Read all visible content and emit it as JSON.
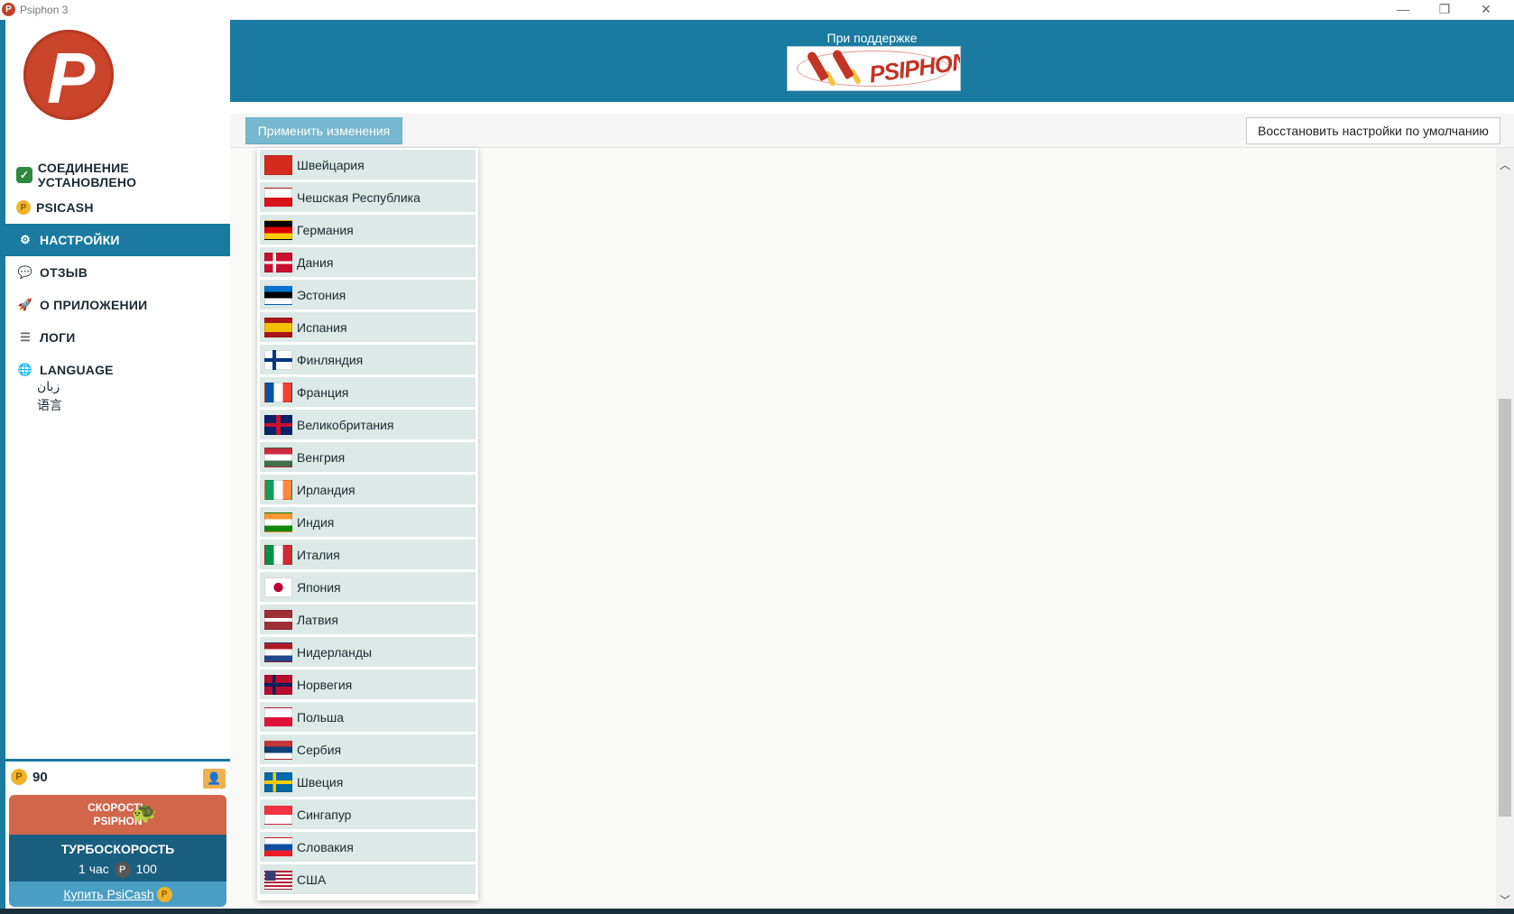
{
  "window": {
    "title": "Psiphon 3",
    "minimize": "—",
    "restore": "❐",
    "close": "✕"
  },
  "sidebar": {
    "logo_letter": "P",
    "items": [
      {
        "label": "СОЕДИНЕНИЕ УСТАНОВЛЕНО",
        "icon": "check-icon",
        "glyph": "✓"
      },
      {
        "label": "PSICASH",
        "icon": "psicash-coin-icon",
        "glyph": "P"
      },
      {
        "label": "НАСТРОЙКИ",
        "icon": "gear-icon",
        "glyph": "⚙"
      },
      {
        "label": "ОТЗЫВ",
        "icon": "chat-bubble-icon",
        "glyph": "💬"
      },
      {
        "label": "О ПРИЛОЖЕНИИ",
        "icon": "rocket-icon",
        "glyph": "🚀"
      },
      {
        "label": "ЛОГИ",
        "icon": "list-icon",
        "glyph": "☰"
      },
      {
        "label": "LANGUAGE",
        "icon": "globe-icon",
        "glyph": "🌐"
      }
    ],
    "language_alt": [
      "زبان",
      "语言"
    ]
  },
  "psicash": {
    "balance": "90",
    "coin_glyph": "P",
    "account_glyph": "👤",
    "speed_line1": "СКОРОСТЬ",
    "speed_line2": "PSIPHON",
    "turbo_title": "ТУРБОСКОРОСТЬ",
    "turbo_duration": "1 час",
    "turbo_price": "100",
    "buy_label": "Купить PsiCash"
  },
  "header": {
    "sponsor_label": "При поддержке",
    "sponsor_word": "PSIPHON"
  },
  "toolbar": {
    "apply_label": "Применить изменения",
    "reset_label": "Восстановить настройки по умолчанию"
  },
  "scrollbar": {
    "up": "︿",
    "down": "﹀"
  },
  "countries": [
    {
      "name": "Швейцария",
      "flag": "ch"
    },
    {
      "name": "Чешская Республика",
      "flag": "cz"
    },
    {
      "name": "Германия",
      "flag": "de"
    },
    {
      "name": "Дания",
      "flag": "dk"
    },
    {
      "name": "Эстония",
      "flag": "ee"
    },
    {
      "name": "Испания",
      "flag": "es"
    },
    {
      "name": "Финляндия",
      "flag": "fi"
    },
    {
      "name": "Франция",
      "flag": "fr"
    },
    {
      "name": "Великобритания",
      "flag": "gb"
    },
    {
      "name": "Венгрия",
      "flag": "hu"
    },
    {
      "name": "Ирландия",
      "flag": "ie"
    },
    {
      "name": "Индия",
      "flag": "in"
    },
    {
      "name": "Италия",
      "flag": "it"
    },
    {
      "name": "Япония",
      "flag": "jp"
    },
    {
      "name": "Латвия",
      "flag": "lv"
    },
    {
      "name": "Нидерланды",
      "flag": "nl"
    },
    {
      "name": "Норвегия",
      "flag": "no"
    },
    {
      "name": "Польша",
      "flag": "pl"
    },
    {
      "name": "Сербия",
      "flag": "rs"
    },
    {
      "name": "Швеция",
      "flag": "se"
    },
    {
      "name": "Сингапур",
      "flag": "sg"
    },
    {
      "name": "Словакия",
      "flag": "sk"
    },
    {
      "name": "США",
      "flag": "us"
    }
  ],
  "colors": {
    "brand_blue": "#1a7aa0",
    "logo_red": "#c9442b",
    "speed_red": "#d2664b",
    "turbo_blue": "#1a5e80",
    "row_bg": "#dce9e6"
  }
}
